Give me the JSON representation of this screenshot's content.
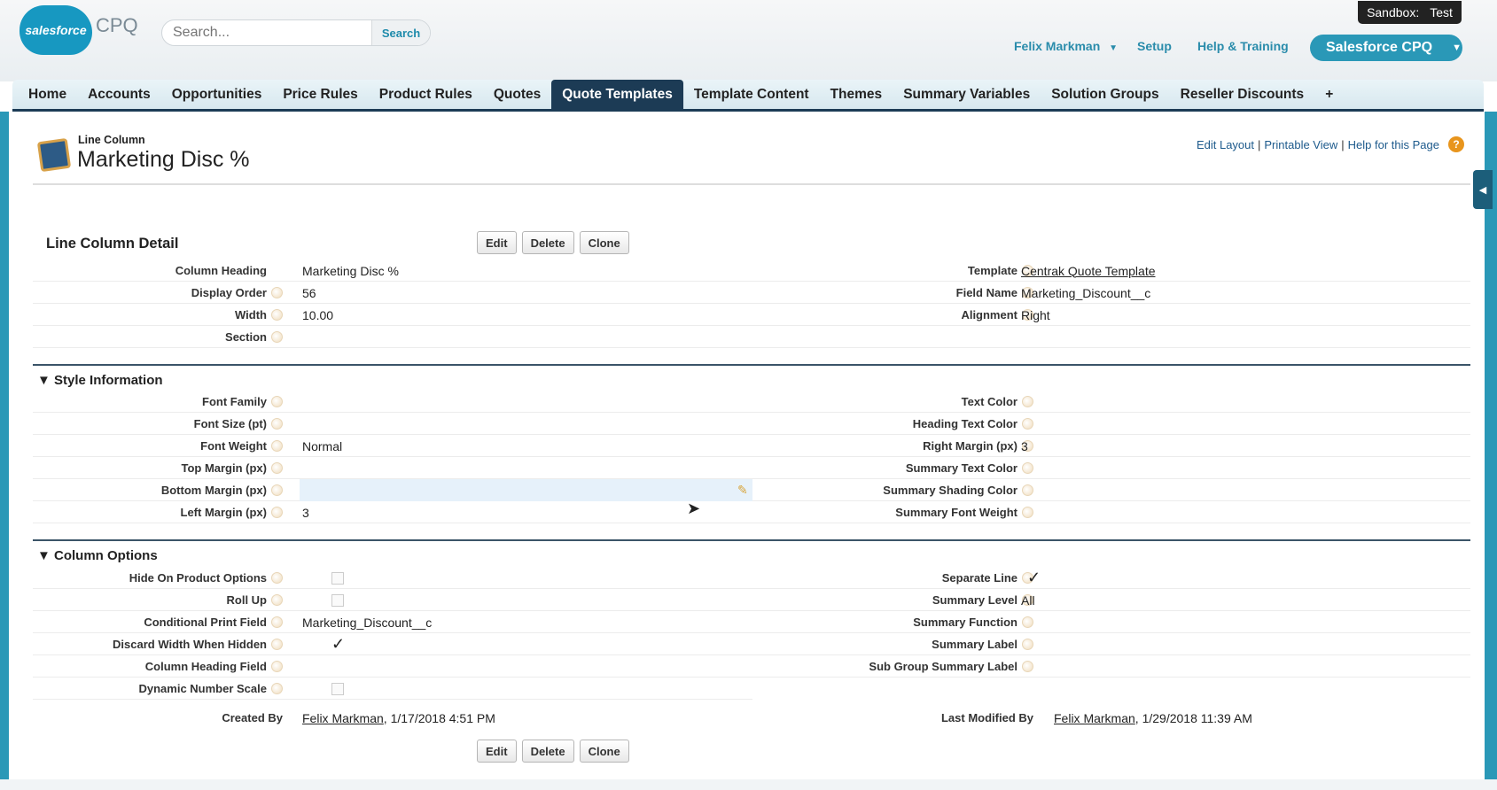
{
  "header": {
    "logo": "salesforce",
    "product": "CPQ",
    "search_placeholder": "Search...",
    "search_button": "Search",
    "sandbox_label": "Sandbox:",
    "sandbox_name": "Test",
    "user": "Felix Markman",
    "setup": "Setup",
    "help": "Help & Training",
    "app": "Salesforce CPQ"
  },
  "tabs": [
    "Home",
    "Accounts",
    "Opportunities",
    "Price Rules",
    "Product Rules",
    "Quotes",
    "Quote Templates",
    "Template Content",
    "Themes",
    "Summary Variables",
    "Solution Groups",
    "Reseller Discounts",
    "+"
  ],
  "page": {
    "type": "Line Column",
    "title": "Marketing Disc %",
    "edit_layout": "Edit Layout",
    "printable": "Printable View",
    "help_page": "Help for this Page",
    "sep": "|"
  },
  "detail": {
    "heading": "Line Column Detail",
    "edit": "Edit",
    "delete": "Delete",
    "clone": "Clone",
    "rows": [
      {
        "l": "Column Heading",
        "v": "Marketing Disc %",
        "rl": "Template",
        "rv": "Centrak Quote Template"
      },
      {
        "l": "Display Order",
        "v": "56",
        "rl": "Field Name",
        "rv": "Marketing_Discount__c"
      },
      {
        "l": "Width",
        "v": "10.00",
        "rl": "Alignment",
        "rv": "Right"
      },
      {
        "l": "Section",
        "v": ""
      }
    ]
  },
  "style": {
    "heading": "Style Information",
    "rows": [
      {
        "l": "Font Family",
        "v": "",
        "rl": "Text Color",
        "rv": ""
      },
      {
        "l": "Font Size (pt)",
        "v": "",
        "rl": "Heading Text Color",
        "rv": ""
      },
      {
        "l": "Font Weight",
        "v": "Normal",
        "rl": "Right Margin (px)",
        "rv": "3"
      },
      {
        "l": "Top Margin (px)",
        "v": "",
        "rl": "Summary Text Color",
        "rv": ""
      },
      {
        "l": "Bottom Margin (px)",
        "v": "",
        "rl": "Summary Shading Color",
        "rv": ""
      },
      {
        "l": "Left Margin (px)",
        "v": "3",
        "rl": "Summary Font Weight",
        "rv": ""
      }
    ]
  },
  "options": {
    "heading": "Column Options",
    "rows": [
      {
        "l": "Hide On Product Options",
        "checked": false,
        "rl": "Separate Line",
        "rchecked": true
      },
      {
        "l": "Roll Up",
        "checked": false,
        "rl": "Summary Level",
        "rv": "All"
      },
      {
        "l": "Conditional Print Field",
        "v": "Marketing_Discount__c",
        "rl": "Summary Function",
        "rv": ""
      },
      {
        "l": "Discard Width When Hidden",
        "checked": true,
        "rl": "Summary Label",
        "rv": ""
      },
      {
        "l": "Column Heading Field",
        "v": "",
        "rl": "Sub Group Summary Label",
        "rv": ""
      },
      {
        "l": "Dynamic Number Scale",
        "checked": false
      }
    ],
    "created_label": "Created By",
    "created_user": "Felix Markman",
    "created_date": ", 1/17/2018 4:51 PM",
    "modified_label": "Last Modified By",
    "modified_user": "Felix Markman",
    "modified_date": ", 1/29/2018 11:39 AM"
  }
}
